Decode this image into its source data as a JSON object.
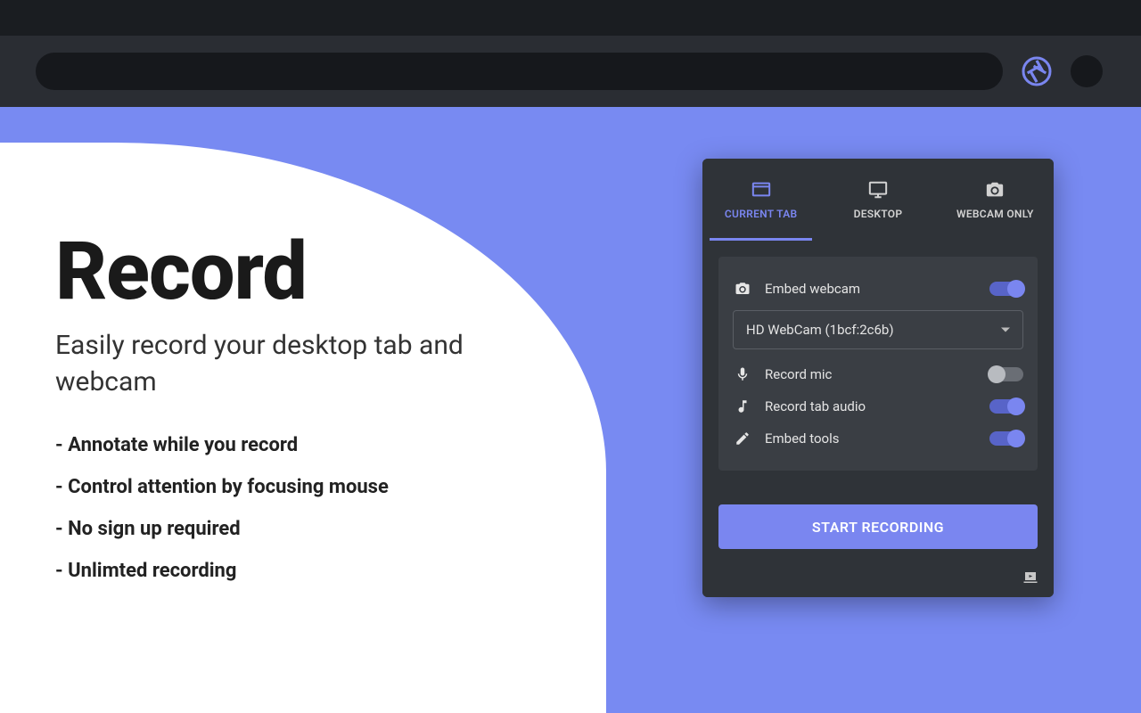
{
  "hero": {
    "title": "Record",
    "subtitle": "Easily record your desktop tab and webcam",
    "bullets": [
      "- Annotate while you record",
      "- Control attention by focusing mouse",
      "- No sign up required",
      "- Unlimted recording"
    ]
  },
  "popup": {
    "tabs": {
      "current": "CURRENT TAB",
      "desktop": "DESKTOP",
      "webcam": "WEBCAM ONLY"
    },
    "options": {
      "embed_webcam": "Embed webcam",
      "webcam_device": "HD WebCam (1bcf:2c6b)",
      "record_mic": "Record mic",
      "record_tab_audio": "Record tab audio",
      "embed_tools": "Embed tools"
    },
    "toggles": {
      "embed_webcam": true,
      "record_mic": false,
      "record_tab_audio": true,
      "embed_tools": true
    },
    "start_button": "START RECORDING"
  }
}
